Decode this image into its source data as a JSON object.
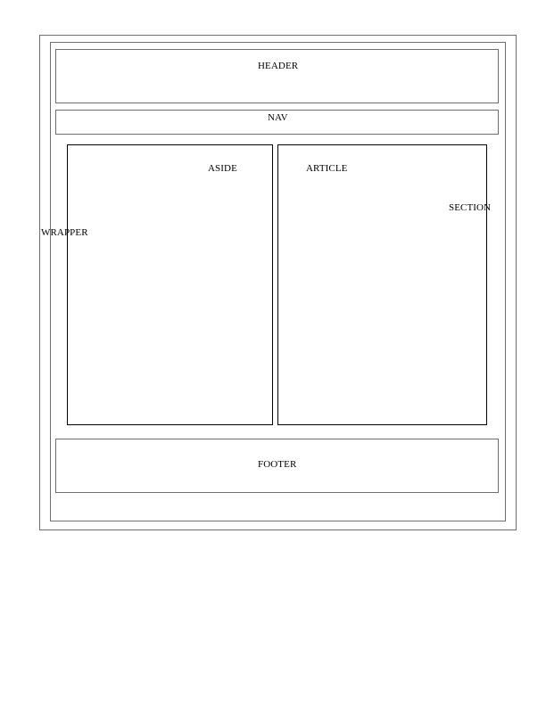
{
  "diagram": {
    "labels": {
      "header": "HEADER",
      "nav": "NAV",
      "aside": "ASIDE",
      "article": "ARTICLE",
      "section": "SECTION",
      "wrapper": "WRAPPER",
      "footer": "FOOTER"
    },
    "colors": {
      "frame_border": "#6e6e6e",
      "content_border": "#000000",
      "text": "#000000",
      "background": "#ffffff"
    }
  }
}
